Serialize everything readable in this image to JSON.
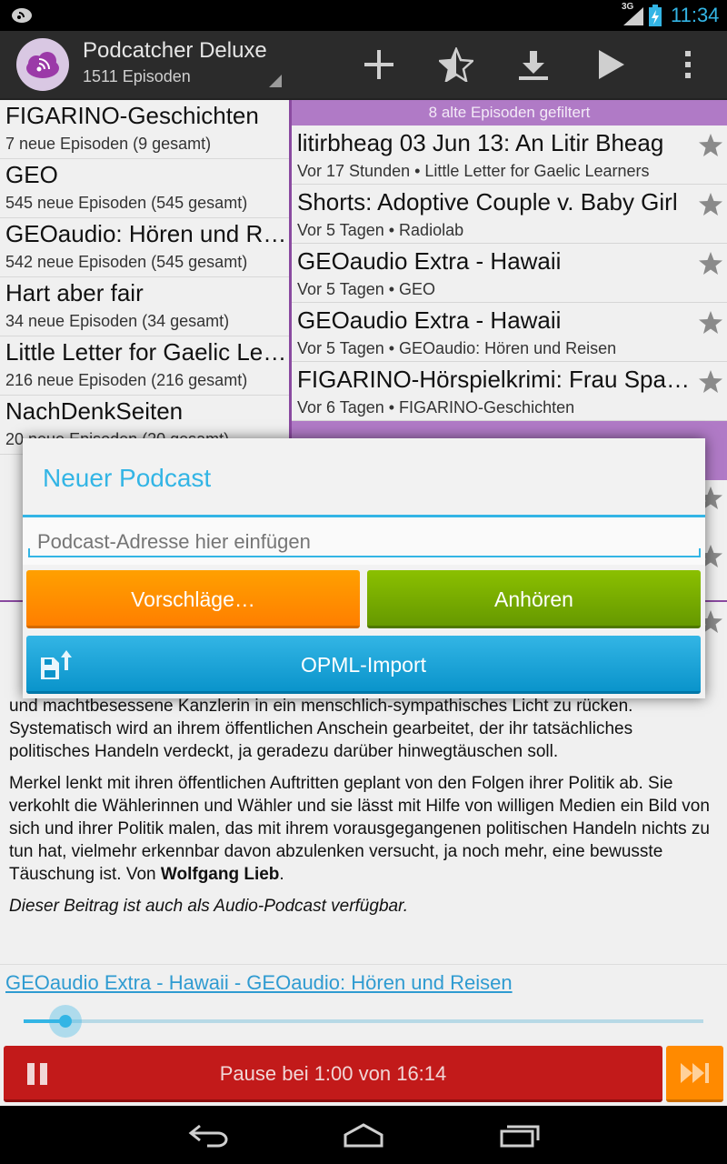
{
  "status_bar": {
    "network": "3G",
    "time": "11:34"
  },
  "action_bar": {
    "title": "Podcatcher Deluxe",
    "subtitle": "1511 Episoden",
    "actions": [
      "add-icon",
      "star-half-icon",
      "download-icon",
      "play-icon",
      "overflow-menu-icon"
    ]
  },
  "podcasts": [
    {
      "title": "FIGARINO-Geschichten",
      "count": "7 neue Episoden (9 gesamt)"
    },
    {
      "title": "GEO",
      "count": "545 neue Episoden (545 gesamt)"
    },
    {
      "title": "GEOaudio: Hören und Reisen",
      "count": "542 neue Episoden (545 gesamt)"
    },
    {
      "title": "Hart aber fair",
      "count": "34 neue Episoden (34 gesamt)"
    },
    {
      "title": "Little Letter for Gaelic Learners",
      "count": "216 neue Episoden (216 gesamt)"
    },
    {
      "title": "NachDenkSeiten",
      "count": "20 neue Episoden (20 gesamt)"
    }
  ],
  "episodes_banner": "8 alte Episoden gefiltert",
  "episodes": [
    {
      "title": "litirbheag 03 Jun 13: An Litir Bheag",
      "meta": "Vor 17 Stunden • Little Letter for Gaelic Learners"
    },
    {
      "title": "Shorts: Adoptive Couple v. Baby Girl",
      "meta": "Vor 5 Tagen • Radiolab"
    },
    {
      "title": "GEOaudio Extra - Hawaii",
      "meta": "Vor 5 Tagen • GEO"
    },
    {
      "title": "GEOaudio Extra - Hawaii",
      "meta": "Vor 5 Tagen • GEOaudio: Hören und Reisen"
    },
    {
      "title": "FIGARINO-Hörspielkrimi: Frau Sparbier",
      "meta": "Vor 6 Tagen • FIGARINO-Geschichten"
    }
  ],
  "description": {
    "p1_end": "und machtbesessene Kanzlerin in ein menschlich-sympathisches Licht zu rücken. Systematisch wird an ihrem öffentlichen Anschein gearbeitet, der ihr tatsächliches politisches Handeln verdeckt, ja geradezu darüber hinwegtäuschen soll.",
    "p2": "Merkel lenkt mit ihren öffentlichen Auftritten geplant von den Folgen ihrer Politik ab. Sie verkohlt die Wählerinnen und Wähler und sie lässt mit Hilfe von willigen Medien ein Bild von sich und ihrer Politik malen, das mit ihrem vorausgegangenen politischen Handeln nichts zu tun hat, vielmehr erkennbar davon abzulenken versucht, ja noch mehr, eine bewusste Täuschung ist. Von ",
    "author": "Wolfgang Lieb",
    "p3": "Dieser Beitrag ist auch als Audio-Podcast verfügbar."
  },
  "player": {
    "now_playing": "GEOaudio Extra - Hawaii - GEOaudio: Hören und Reisen",
    "status": "Pause bei 1:00 von 16:14",
    "progress": 0.062
  },
  "dialog": {
    "title": "Neuer Podcast",
    "input_placeholder": "Podcast-Adresse hier einfügen",
    "suggest_label": "Vorschläge…",
    "listen_label": "Anhören",
    "opml_label": "OPML-Import"
  },
  "colors": {
    "accent": "#33b5e5",
    "purple": "#8a4aa0",
    "orange": "#ff8a00",
    "green": "#669900",
    "red": "#c21a1a"
  }
}
